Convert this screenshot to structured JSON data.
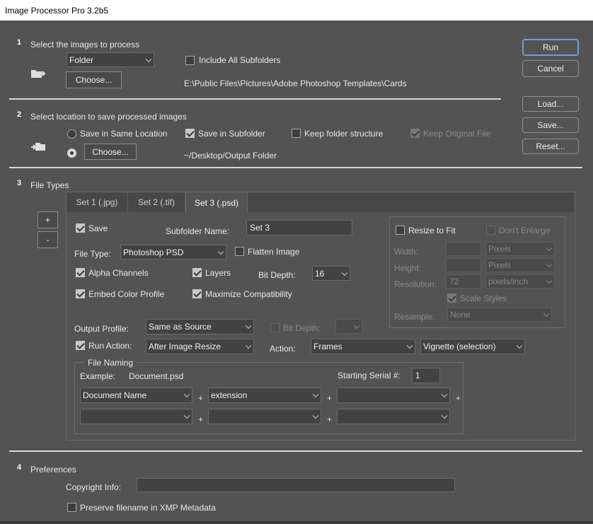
{
  "window": {
    "title": "Image Processor Pro 3.2b5"
  },
  "section1": {
    "num": "1",
    "title": "Select the images to process",
    "source_select": "Folder",
    "include_subfolders": "Include All Subfolders",
    "choose": "Choose...",
    "path": "E:\\Public Files\\Pictures\\Adobe Photoshop Templates\\Cards"
  },
  "section2": {
    "num": "2",
    "title": "Select location to save processed images",
    "same_location": "Save in Same Location",
    "save_subfolder": "Save in Subfolder",
    "keep_structure": "Keep folder structure",
    "keep_original": "Keep Original File",
    "choose": "Choose...",
    "path": "~/Desktop/Output Folder"
  },
  "section3": {
    "num": "3",
    "title": "File Types",
    "add": "+",
    "remove": "-",
    "tabs": [
      "Set 1 (.jpg)",
      "Set 2 (.tif)",
      "Set 3 (.psd)"
    ],
    "save": "Save",
    "subfolder_label": "Subfolder Name:",
    "subfolder_value": "Set 3",
    "file_type_label": "File Type:",
    "file_type": "Photoshop PSD",
    "flatten": "Flatten Image",
    "alpha": "Alpha Channels",
    "layers": "Layers",
    "bit_depth_label": "Bit Depth:",
    "bit_depth": "16",
    "embed_profile": "Embed Color Profile",
    "max_compat": "Maximize Compatibility",
    "resize_to_fit": "Resize to Fit",
    "dont_enlarge": "Don't Enlarge",
    "width_label": "Width:",
    "height_label": "Height:",
    "resolution_label": "Resolution:",
    "units_pixels": "Pixels",
    "resolution_value": "72",
    "units_resolution": "pixels/inch",
    "scale_styles": "Scale Styles",
    "resample_label": "Resample:",
    "resample": "None",
    "output_profile_label": "Output Profile:",
    "output_profile": "Same as Source",
    "bit_depth2_label": "Bit Depth:",
    "run_action": "Run Action:",
    "run_action_when": "After Image Resize",
    "action_label": "Action:",
    "action_set": "Frames",
    "action_name": "Vignette (selection)",
    "file_naming": {
      "legend": "File Naming",
      "example_label": "Example:",
      "example": "Document.psd",
      "serial_label": "Starting Serial #:",
      "serial": "1",
      "field1": "Document Name",
      "field2": "extension",
      "plus": "+"
    }
  },
  "section4": {
    "num": "4",
    "title": "Preferences",
    "copyright_label": "Copyright Info:",
    "preserve": "Preserve filename in XMP Metadata"
  },
  "buttons": {
    "run": "Run",
    "cancel": "Cancel",
    "load": "Load...",
    "save": "Save...",
    "reset": "Reset..."
  }
}
